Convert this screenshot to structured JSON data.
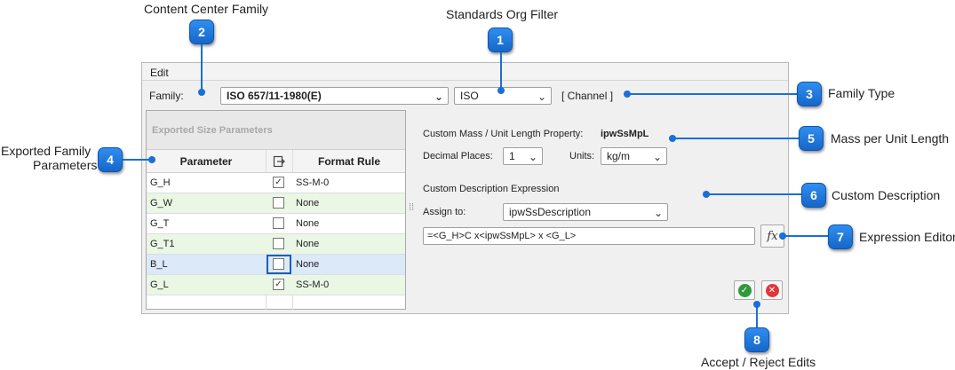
{
  "callouts": {
    "c1": {
      "num": "1",
      "text": "Standards Org Filter"
    },
    "c2": {
      "num": "2",
      "text": "Content Center Family"
    },
    "c3": {
      "num": "3",
      "text": "Family Type"
    },
    "c4": {
      "num": "4",
      "text_line1": "Exported  Family",
      "text_line2": "Parameters"
    },
    "c5": {
      "num": "5",
      "text": "Mass per Unit Length"
    },
    "c6": {
      "num": "6",
      "text": "Custom Description"
    },
    "c7": {
      "num": "7",
      "text": "Expression Editor"
    },
    "c8": {
      "num": "8",
      "text": "Accept / Reject Edits"
    }
  },
  "window": {
    "menu": "Edit",
    "family_label": "Family:",
    "family_value": "ISO 657/11-1980(E)",
    "org_value": "ISO",
    "family_type": "[ Channel ]",
    "grid": {
      "band_title": "Exported Size Parameters",
      "headers": {
        "parameter": "Parameter",
        "format": "Format Rule"
      },
      "rows": [
        {
          "param": "G_H",
          "checked": "✓",
          "format": "SS-M-0"
        },
        {
          "param": "G_W",
          "checked": "",
          "format": "None"
        },
        {
          "param": "G_T",
          "checked": "",
          "format": "None"
        },
        {
          "param": "G_T1",
          "checked": "",
          "format": "None"
        },
        {
          "param": "B_L",
          "checked": "",
          "format": "None"
        },
        {
          "param": "G_L",
          "checked": "✓",
          "format": "SS-M-0"
        }
      ]
    },
    "mass": {
      "label": "Custom Mass / Unit Length Property:",
      "value": "ipwSsMpL",
      "decimal_label": "Decimal Places:",
      "decimal_value": "1",
      "units_label": "Units:",
      "units_value": "kg/m"
    },
    "description": {
      "section_label": "Custom Description Expression",
      "assign_label": "Assign to:",
      "assign_value": "ipwSsDescription",
      "expression": "=<G_H>C x<ipwSsMpL> x <G_L>"
    }
  },
  "colors": {
    "accent": "#1a6fd8",
    "row_alt": "#e9f7e4",
    "row_selected": "#dbe9f9",
    "accept": "#2e9a3e",
    "reject": "#e0373a"
  }
}
